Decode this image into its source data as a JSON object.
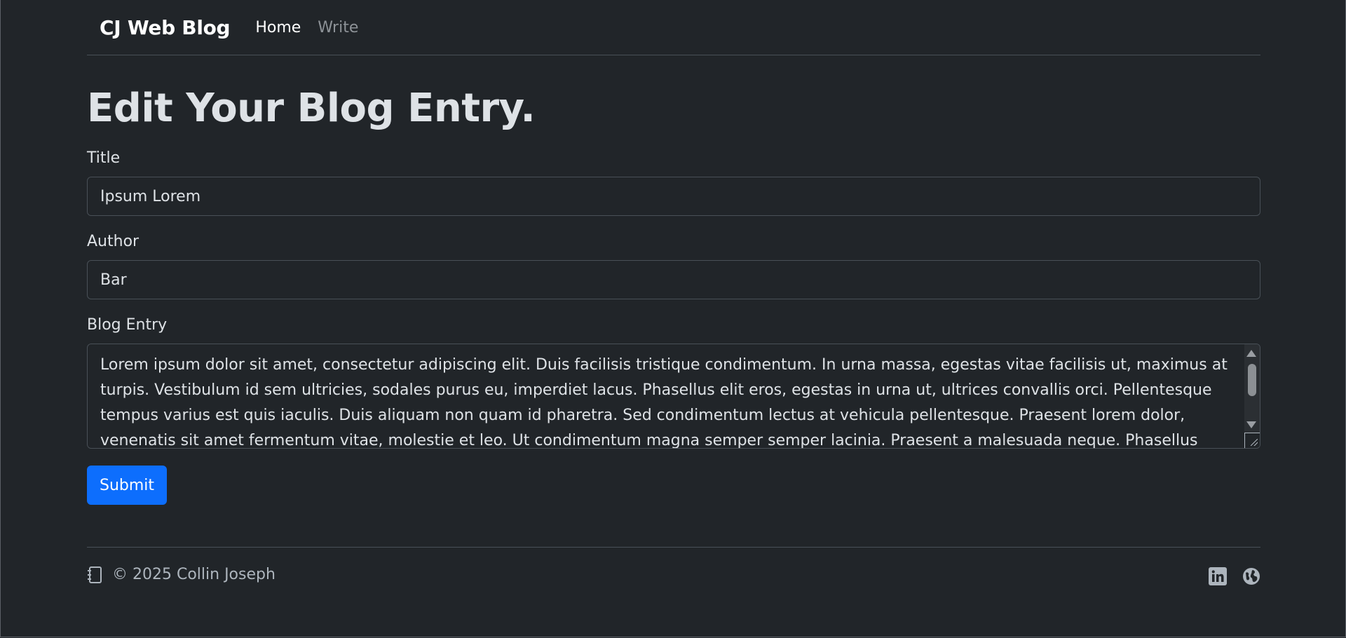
{
  "navbar": {
    "brand": "CJ Web Blog",
    "links": [
      {
        "label": "Home",
        "active": true
      },
      {
        "label": "Write",
        "active": false
      }
    ]
  },
  "page": {
    "heading": "Edit Your Blog Entry."
  },
  "form": {
    "title": {
      "label": "Title",
      "value": "Ipsum Lorem"
    },
    "author": {
      "label": "Author",
      "value": "Bar"
    },
    "entry": {
      "label": "Blog Entry",
      "value": "Lorem ipsum dolor sit amet, consectetur adipiscing elit. Duis facilisis tristique condimentum. In urna massa, egestas vitae facilisis ut, maximus at turpis. Vestibulum id sem ultricies, sodales purus eu, imperdiet lacus. Phasellus elit eros, egestas in urna ut, ultrices convallis orci. Pellentesque tempus varius est quis iaculis. Duis aliquam non quam id pharetra. Sed condimentum lectus at vehicula pellentesque. Praesent lorem dolor, venenatis sit amet fermentum vitae, molestie et leo. Ut condimentum magna semper semper lacinia. Praesent a malesuada neque. Phasellus facilisis faucibus metus eu fringilla."
    },
    "submit_label": "Submit"
  },
  "footer": {
    "copyright": "© 2025 Collin Joseph",
    "icons": [
      "journal-icon",
      "linkedin-icon",
      "globe-icon"
    ]
  },
  "colors": {
    "background": "#212529",
    "primary": "#0d6efd",
    "text": "#dee2e6",
    "muted": "#adb5bd",
    "border": "#495057"
  }
}
